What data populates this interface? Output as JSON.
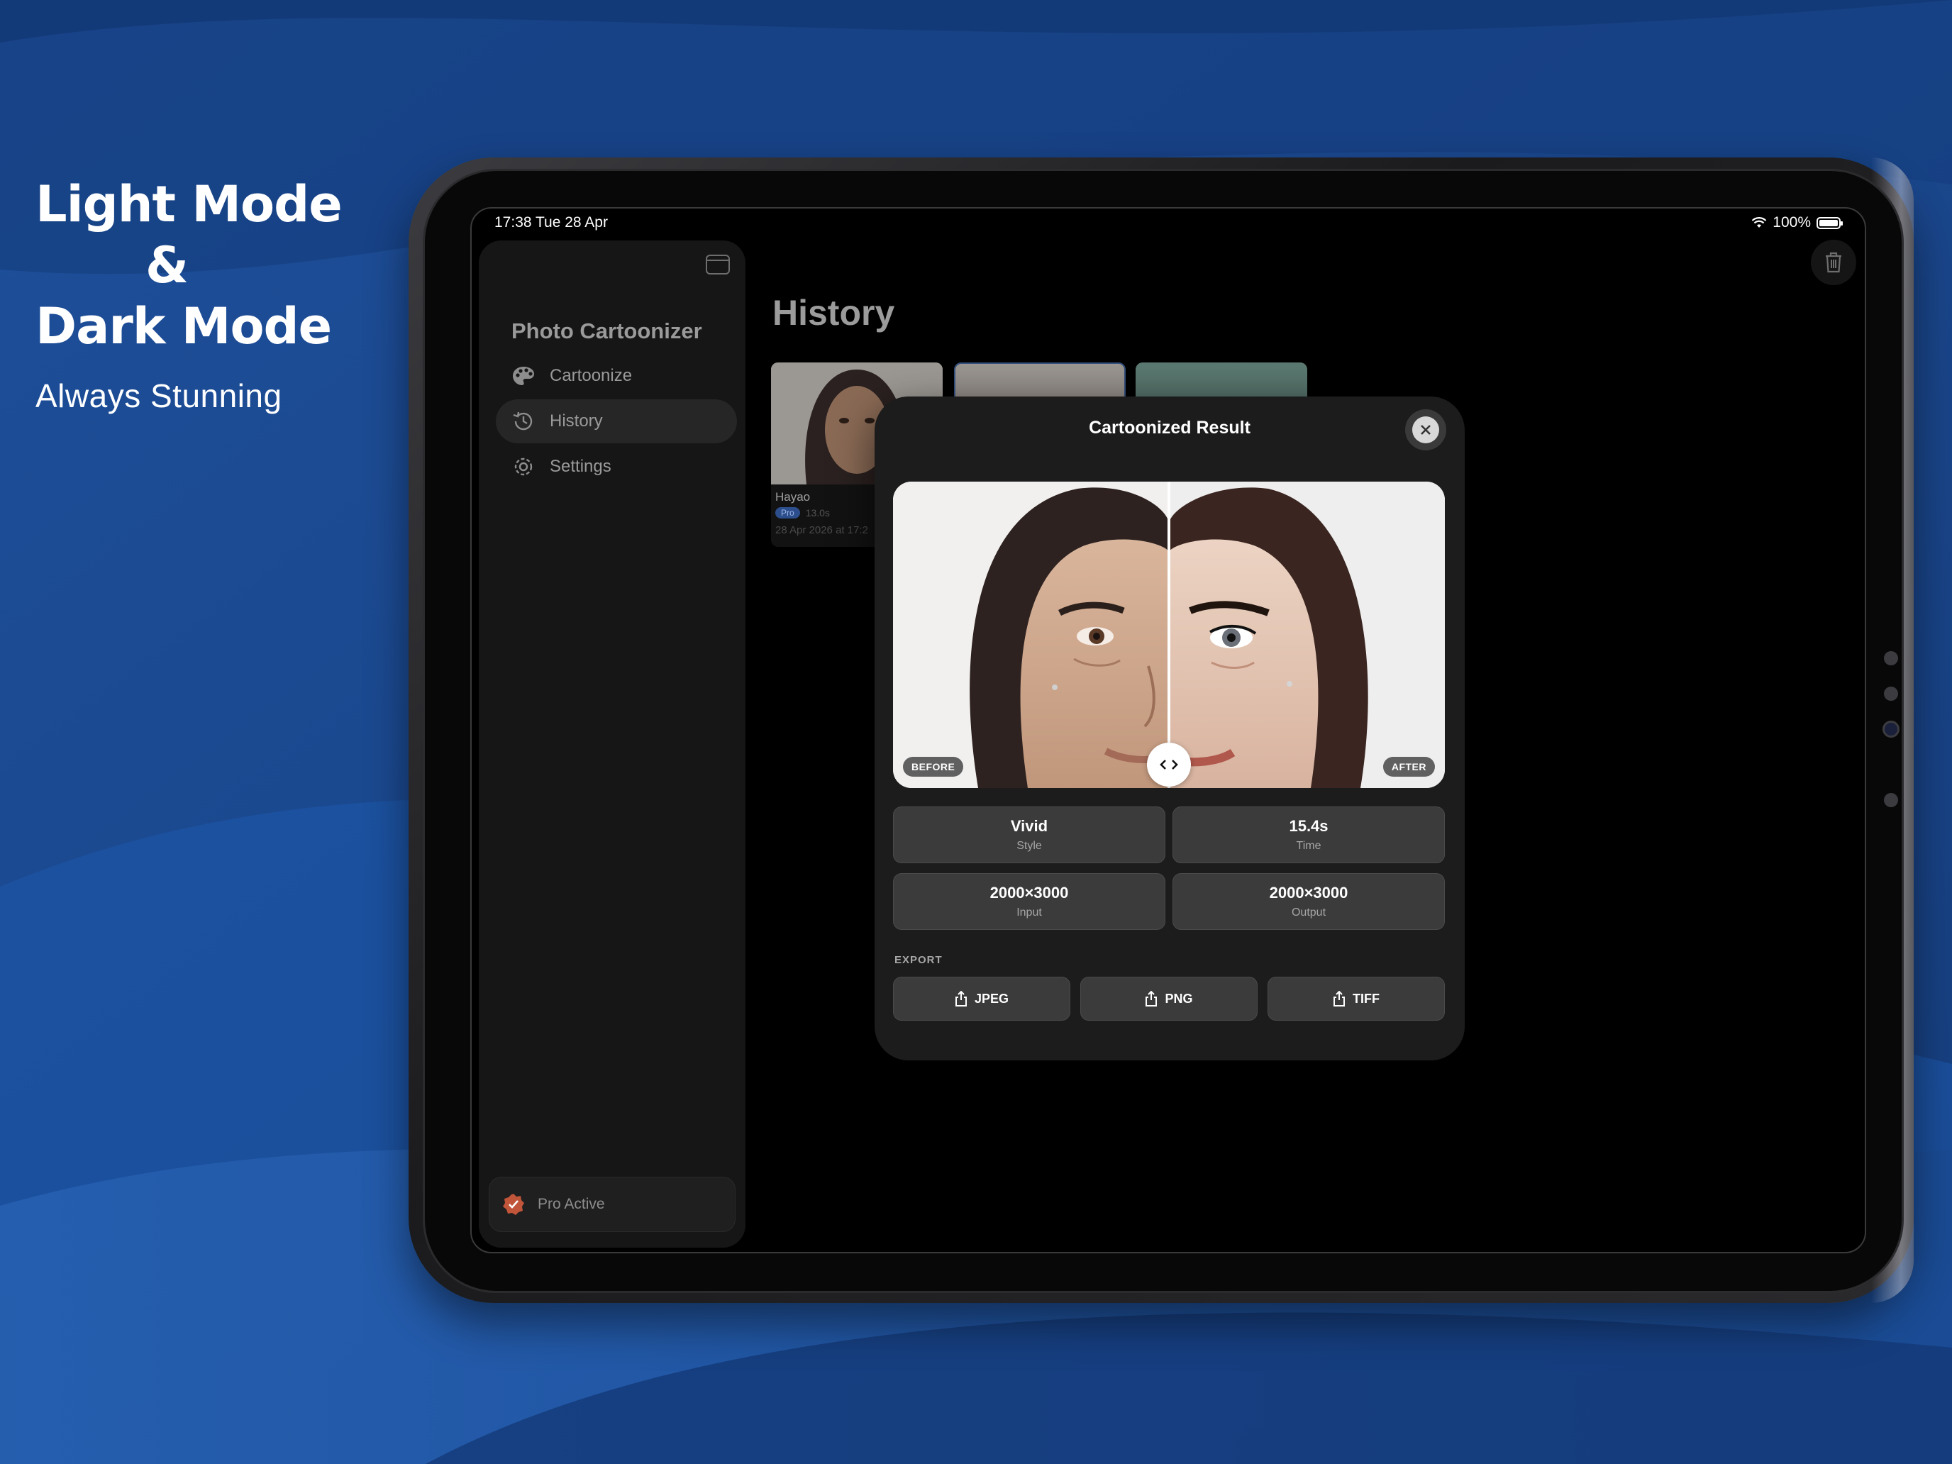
{
  "promo": {
    "line1": "Light Mode",
    "line2": "&",
    "line3": "Dark Mode",
    "subtitle": "Always Stunning"
  },
  "status": {
    "time_date": "17:38  Tue 28 Apr",
    "battery": "100%"
  },
  "sidebar": {
    "app_title": "Photo Cartoonizer",
    "items": [
      {
        "label": "Cartoonize",
        "icon": "palette-icon",
        "active": false
      },
      {
        "label": "History",
        "icon": "clock-history-icon",
        "active": true
      },
      {
        "label": "Settings",
        "icon": "gear-icon",
        "active": false
      }
    ],
    "pro_status": "Pro Active"
  },
  "main": {
    "title": "History",
    "cards": [
      {
        "style": "Hayao",
        "badge": "Pro",
        "time": "13.0s",
        "date": "28 Apr 2026 at 17:2"
      }
    ]
  },
  "modal": {
    "title": "Cartoonized Result",
    "before_label": "BEFORE",
    "after_label": "AFTER",
    "stats": [
      {
        "value": "Vivid",
        "label": "Style"
      },
      {
        "value": "15.4s",
        "label": "Time"
      },
      {
        "value": "2000×3000",
        "label": "Input"
      },
      {
        "value": "2000×3000",
        "label": "Output"
      }
    ],
    "export_label": "EXPORT",
    "export_buttons": [
      "JPEG",
      "PNG",
      "TIFF"
    ]
  },
  "colors": {
    "background": "#1b4a92",
    "accent_blue": "#2d4e8c",
    "pro_badge": "#c0553a"
  }
}
